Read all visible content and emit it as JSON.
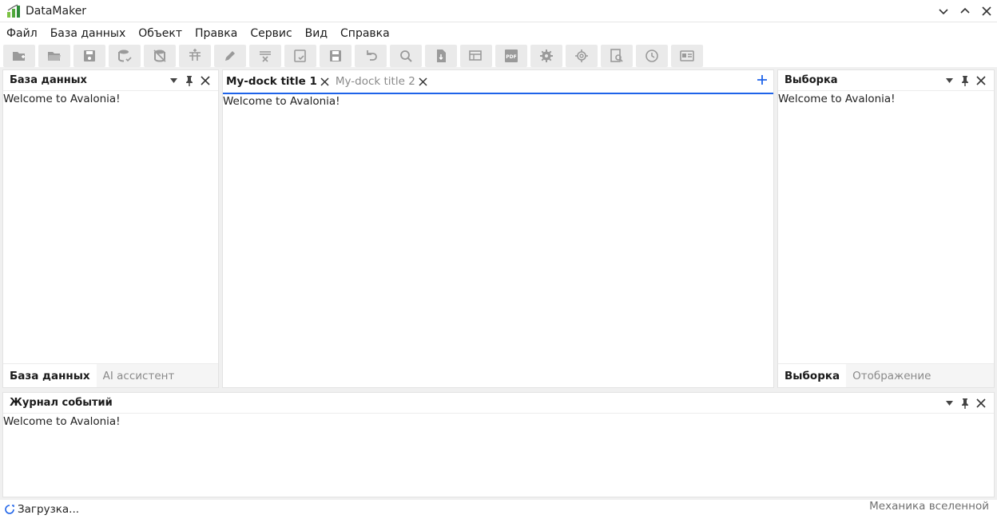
{
  "app": {
    "title": "DataMaker",
    "accent_color": "#1e63e9",
    "logo_colors": [
      "#7cc243",
      "#4fa83a",
      "#2e8b3a"
    ]
  },
  "menu": {
    "items": [
      "Файл",
      "База данных",
      "Объект",
      "Правка",
      "Сервис",
      "Вид",
      "Справка"
    ]
  },
  "toolbar": {
    "buttons": [
      "new-folder-icon",
      "open-folder-icon",
      "save-icon",
      "database-check-icon",
      "database-off-icon",
      "table-add-icon",
      "edit-pencil-icon",
      "table-remove-icon",
      "save-check-icon",
      "save-all-icon",
      "undo-icon",
      "refresh-search-icon",
      "file-export-icon",
      "table-edit-icon",
      "pdf-icon",
      "gear-icon",
      "gear-outline-icon",
      "document-search-icon",
      "history-icon",
      "id-card-icon"
    ]
  },
  "left_panel": {
    "title": "База данных",
    "content": "Welcome to Avalonia!",
    "tabs": [
      {
        "label": "База данных",
        "active": true
      },
      {
        "label": "AI ассистент",
        "active": false
      }
    ]
  },
  "center_panel": {
    "tabs": [
      {
        "label": "My-dock title 1",
        "active": true
      },
      {
        "label": "My-dock title 2",
        "active": false
      }
    ],
    "content": "Welcome to Avalonia!"
  },
  "right_panel": {
    "title": "Выборка",
    "content": "Welcome to Avalonia!",
    "tabs": [
      {
        "label": "Выборка",
        "active": true
      },
      {
        "label": "Отображение",
        "active": false
      }
    ]
  },
  "bottom_panel": {
    "title": "Журнал событий",
    "content": "Welcome to Avalonia!"
  },
  "status": {
    "text": "Загрузка...",
    "right_text": "Механика вселенной"
  }
}
